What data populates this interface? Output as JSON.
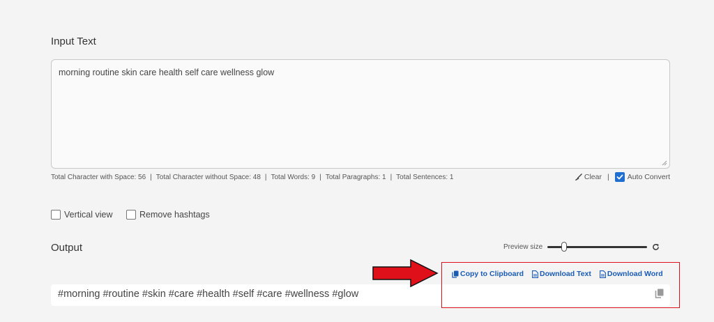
{
  "input": {
    "heading": "Input Text",
    "value": "morning routine skin care health self care wellness glow"
  },
  "stats": {
    "with_space": "Total Character with Space: 56",
    "without_space": "Total Character without Space: 48",
    "words": "Total Words: 9",
    "paragraphs": "Total Paragraphs: 1",
    "sentences": "Total Sentences: 1",
    "separator": "|"
  },
  "tools": {
    "clear_label": "Clear",
    "clear_icon": "broom-icon",
    "separator": "|",
    "auto_convert_label": "Auto Convert",
    "auto_convert_checked": true
  },
  "options": {
    "vertical_view_label": "Vertical view",
    "vertical_view_checked": false,
    "remove_hashtags_label": "Remove hashtags",
    "remove_hashtags_checked": false
  },
  "output": {
    "heading": "Output",
    "preview_label": "Preview size",
    "preview_level": 0.15,
    "value": "#morning #routine #skin #care #health #self #care #wellness #glow"
  },
  "actions": {
    "copy_label": "Copy to Clipboard",
    "download_text_label": "Download Text",
    "download_word_label": "Download Word"
  },
  "colors": {
    "link": "#1a5bb5",
    "checkbox": "#1f6fd0",
    "annotation": "#e0101a"
  }
}
